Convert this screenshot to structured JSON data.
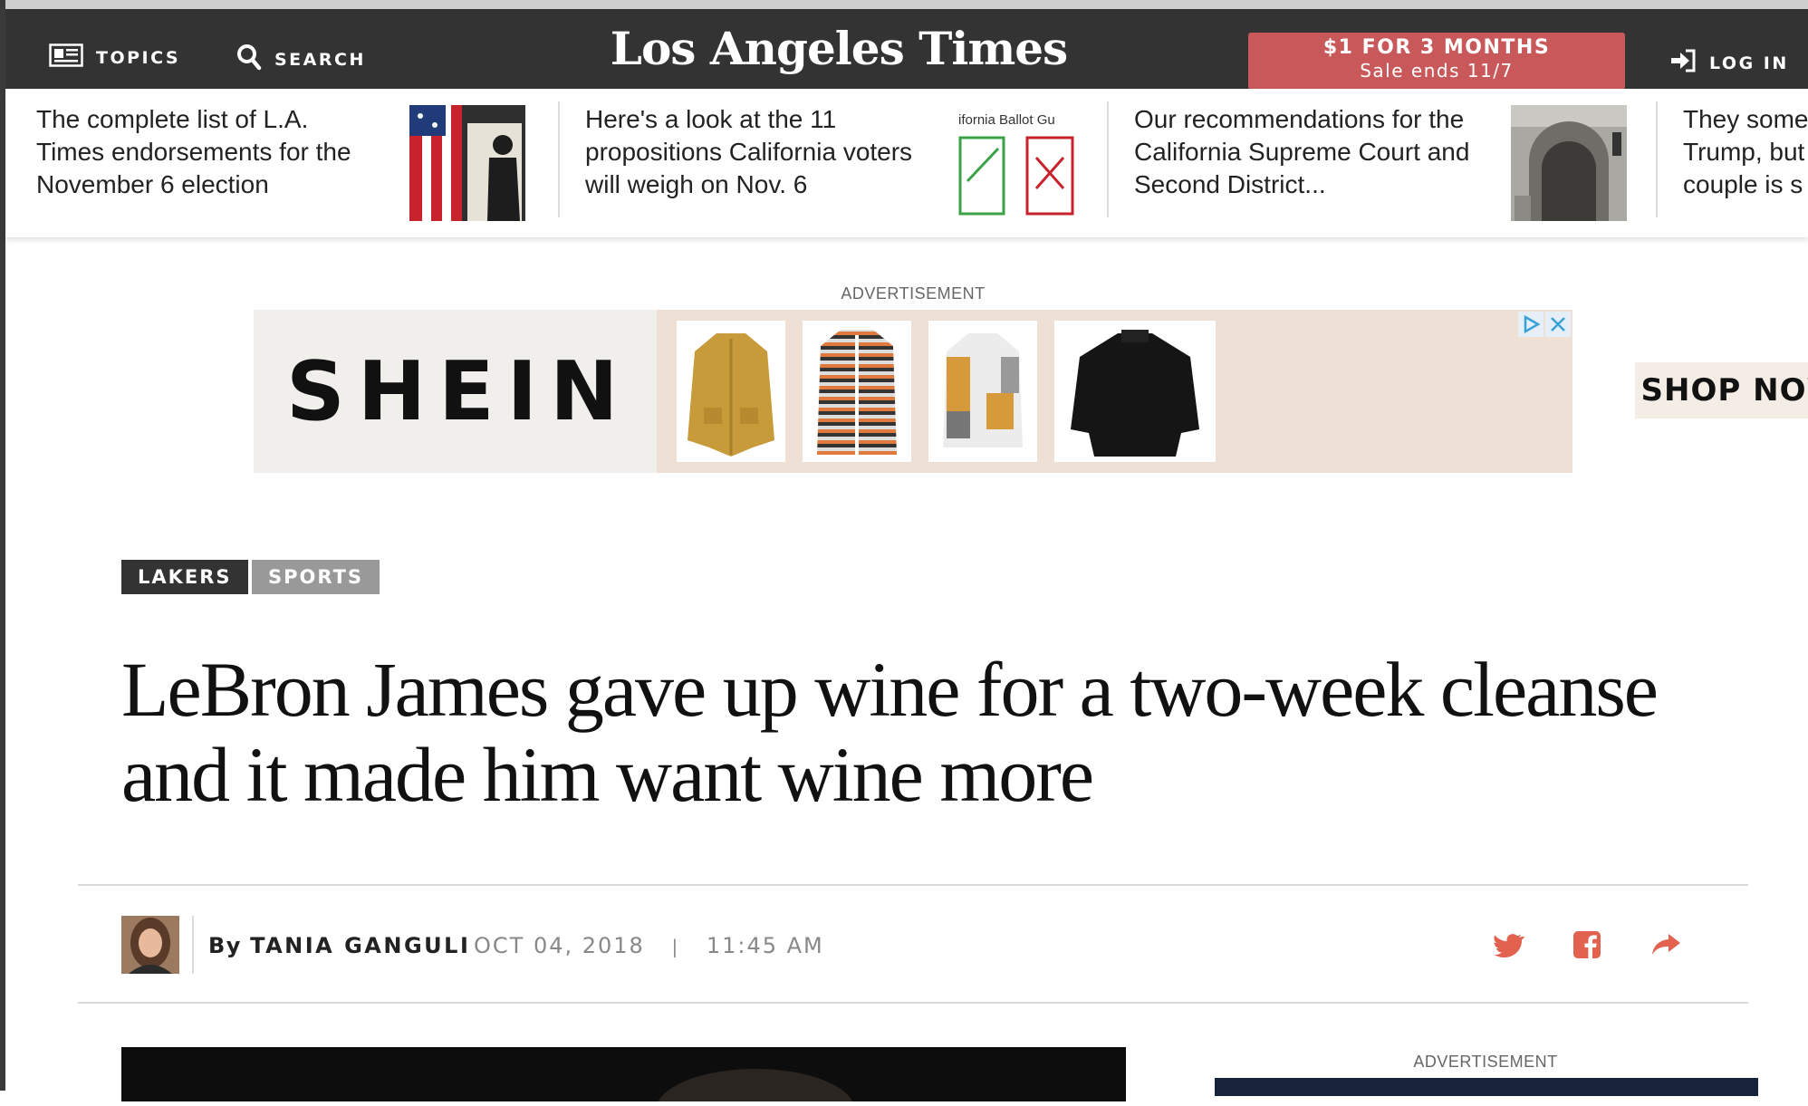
{
  "header": {
    "topics_label": "TOPICS",
    "search_label": "SEARCH",
    "logo_text": "Los Angeles Times",
    "promo_line1": "$1 FOR 3 MONTHS",
    "promo_line2": "Sale ends 11/7",
    "login_label": "LOG IN",
    "colors": {
      "bar": "#333333",
      "promo": "#c9585a"
    }
  },
  "ticker": [
    {
      "text": "The complete list of L.A. Times endorsements for the November 6 election",
      "thumb": "flag-voting-booth-photo"
    },
    {
      "text": "Here's a look at the 11 propositions California voters will weigh on Nov. 6",
      "thumb": "ballot-guide-graphic",
      "thumb_caption": "ifornia Ballot Gu"
    },
    {
      "text": "Our recommendations for the California Supreme Court and Second District...",
      "thumb": "courthouse-photo"
    },
    {
      "text": "They some Trump, but couple is s",
      "thumb": ""
    }
  ],
  "ad": {
    "label": "ADVERTISEMENT",
    "brand": "SHEIN",
    "cta": "SHOP NOW>"
  },
  "tags": [
    "LAKERS",
    "SPORTS"
  ],
  "headline": "LeBron James gave up wine for a two-week cleanse and it made him want wine more",
  "byline": {
    "by": "By",
    "author": "TANIA GANGULI",
    "date": "OCT 04, 2018",
    "separator": "|",
    "time": "11:45 AM"
  },
  "share_icons": [
    "twitter-icon",
    "facebook-icon",
    "share-arrow-icon"
  ],
  "share_color": "#e2614f",
  "sidebar_ad_label": "ADVERTISEMENT"
}
